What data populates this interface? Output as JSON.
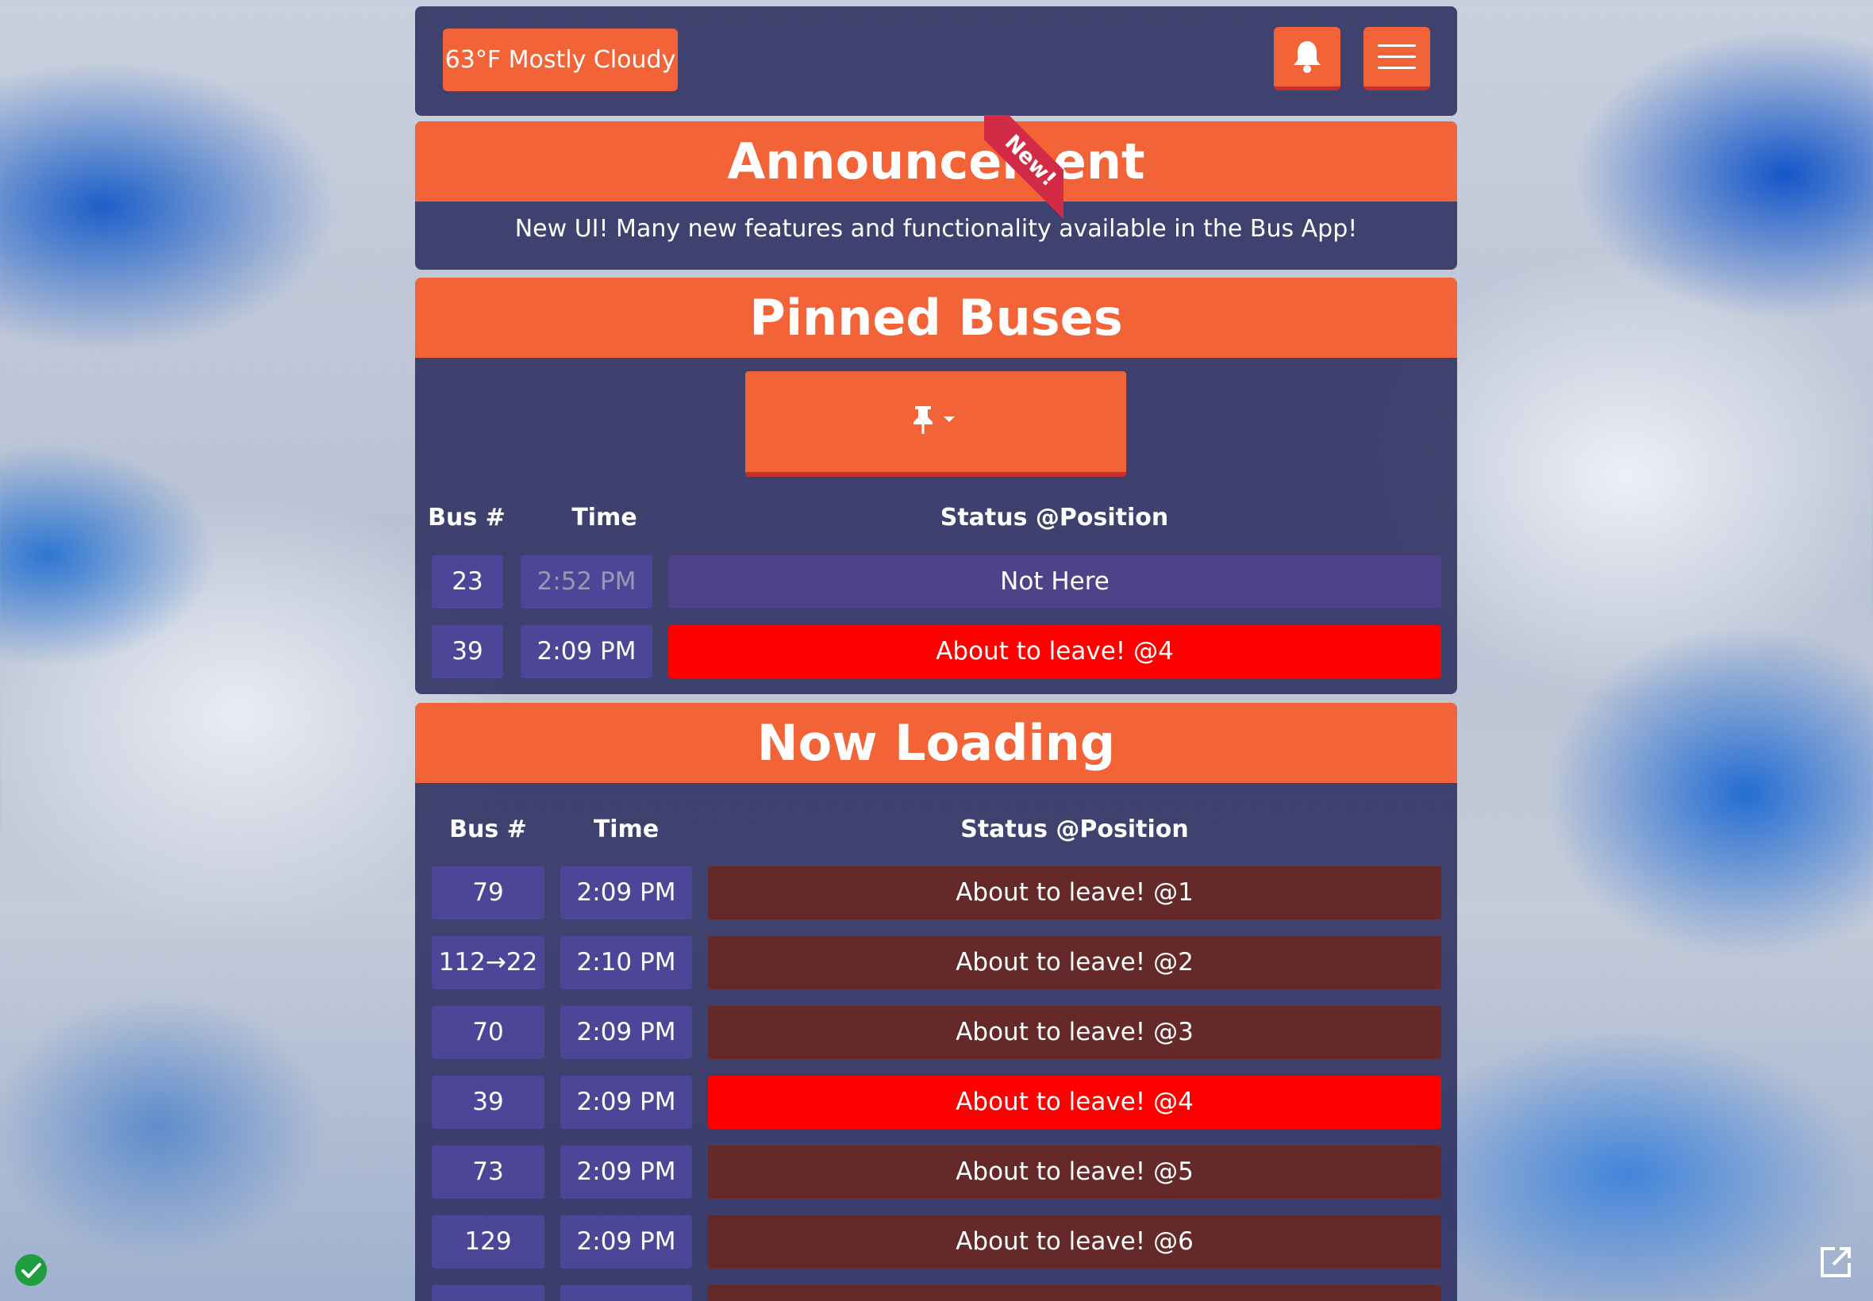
{
  "header": {
    "weather": "63°F Mostly Cloudy",
    "icons": [
      "bell-icon",
      "hamburger-menu-icon"
    ]
  },
  "announcement": {
    "title": "Announcement",
    "text": "New UI! Many new features and functionality available in the Bus App!",
    "ribbon": "New!"
  },
  "pinned": {
    "title": "Pinned Buses",
    "pin_icon": "pushpin-icon",
    "columns": {
      "bus": "Bus #",
      "time": "Time",
      "status": "Status @Position"
    },
    "rows": [
      {
        "bus": "23",
        "time": "2:52 PM",
        "status": "Not Here"
      },
      {
        "bus": "39",
        "time": "2:09 PM",
        "status": "About to leave! @4"
      }
    ]
  },
  "loading": {
    "title": "Now Loading",
    "columns": {
      "bus": "Bus #",
      "time": "Time",
      "status": "Status @Position"
    },
    "rows": [
      {
        "bus": "79",
        "time": "2:09 PM",
        "status": "About to leave! @1"
      },
      {
        "bus": "112→22",
        "time": "2:10 PM",
        "status": "About to leave! @2"
      },
      {
        "bus": "70",
        "time": "2:09 PM",
        "status": "About to leave! @3"
      },
      {
        "bus": "39",
        "time": "2:09 PM",
        "status": "About to leave! @4"
      },
      {
        "bus": "73",
        "time": "2:09 PM",
        "status": "About to leave! @5"
      },
      {
        "bus": "129",
        "time": "2:09 PM",
        "status": "About to leave! @6"
      }
    ]
  },
  "colors": {
    "accent": "#f26337",
    "panel": "#2c2d5f",
    "highlight": "#ff0000",
    "status_dark": "#662929"
  }
}
